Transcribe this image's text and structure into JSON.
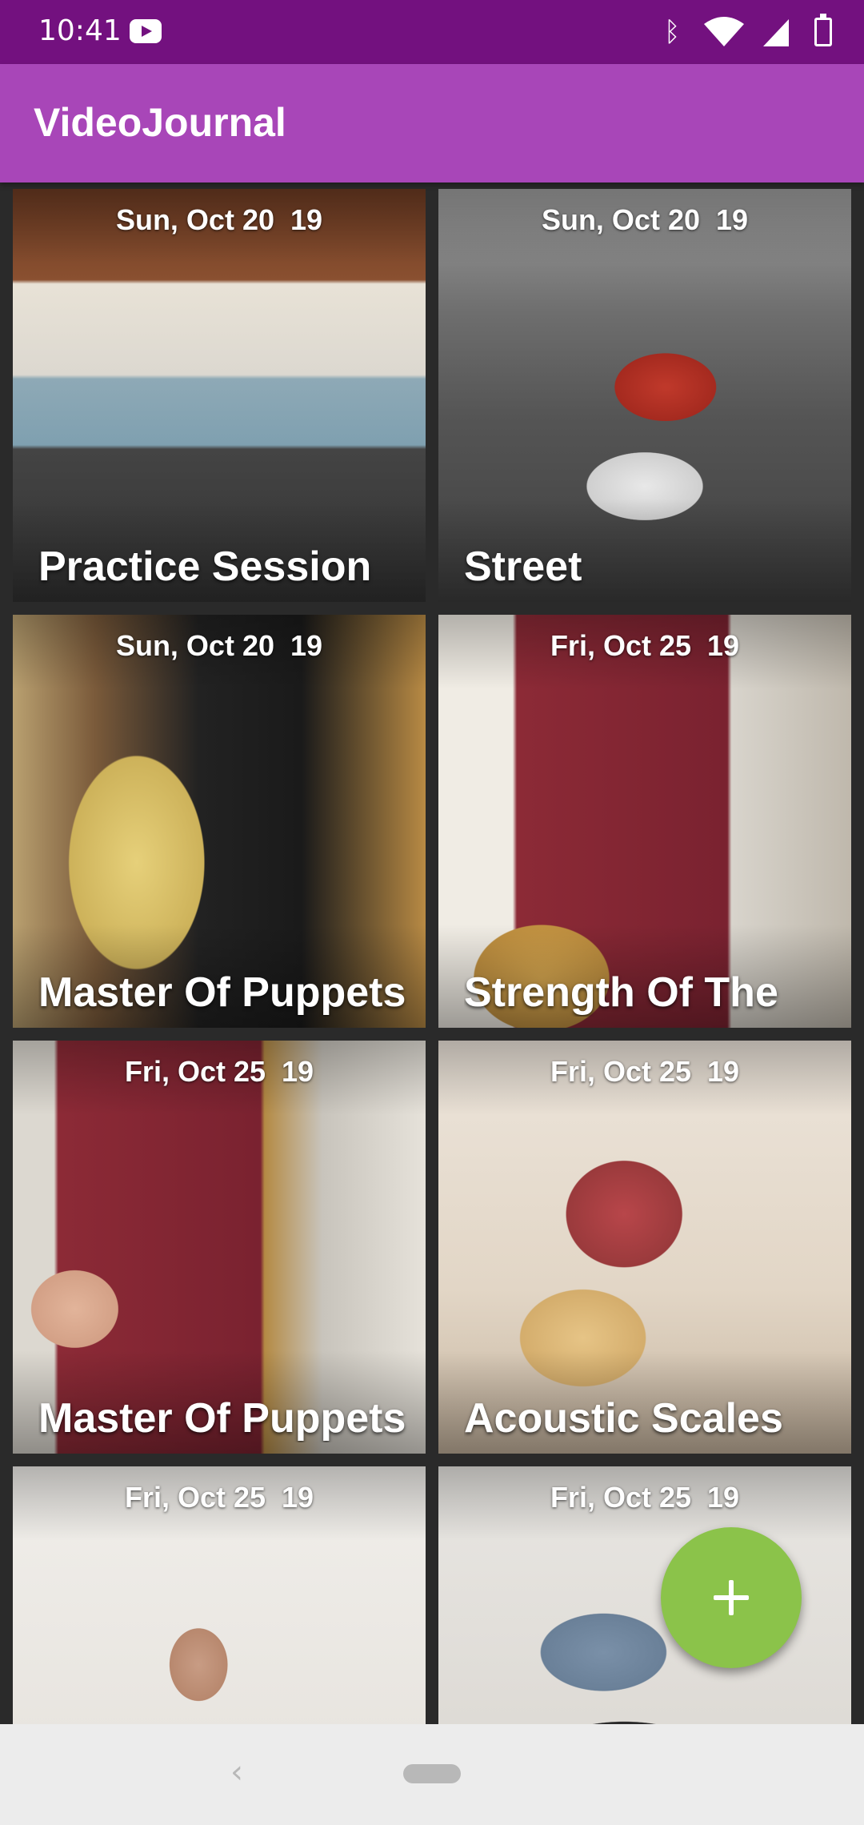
{
  "status_bar": {
    "time": "10:41",
    "icons": [
      "youtube-icon",
      "bluetooth-icon",
      "wifi-icon",
      "signal-icon",
      "battery-icon"
    ]
  },
  "app_bar": {
    "title": "VideoJournal"
  },
  "colors": {
    "status_bar": "#73117f",
    "app_bar": "#a846b8",
    "fab": "#8bc34a",
    "nav_bar": "#ececec"
  },
  "videos": [
    {
      "date": "Sun, Oct 20  19",
      "title": "Practice Session"
    },
    {
      "date": "Sun, Oct 20  19",
      "title": "Street"
    },
    {
      "date": "Sun, Oct 20  19",
      "title": "Master Of Puppets"
    },
    {
      "date": "Fri, Oct 25  19",
      "title": "Strength Of The"
    },
    {
      "date": "Fri, Oct 25  19",
      "title": "Master Of Puppets"
    },
    {
      "date": "Fri, Oct 25  19",
      "title": "Acoustic Scales"
    },
    {
      "date": "Fri, Oct 25  19",
      "title": ""
    },
    {
      "date": "Fri, Oct 25  19",
      "title": ""
    }
  ],
  "fab": {
    "icon": "plus-icon"
  },
  "nav_bar": {
    "icons": [
      "back-icon",
      "home-pill-icon"
    ]
  }
}
